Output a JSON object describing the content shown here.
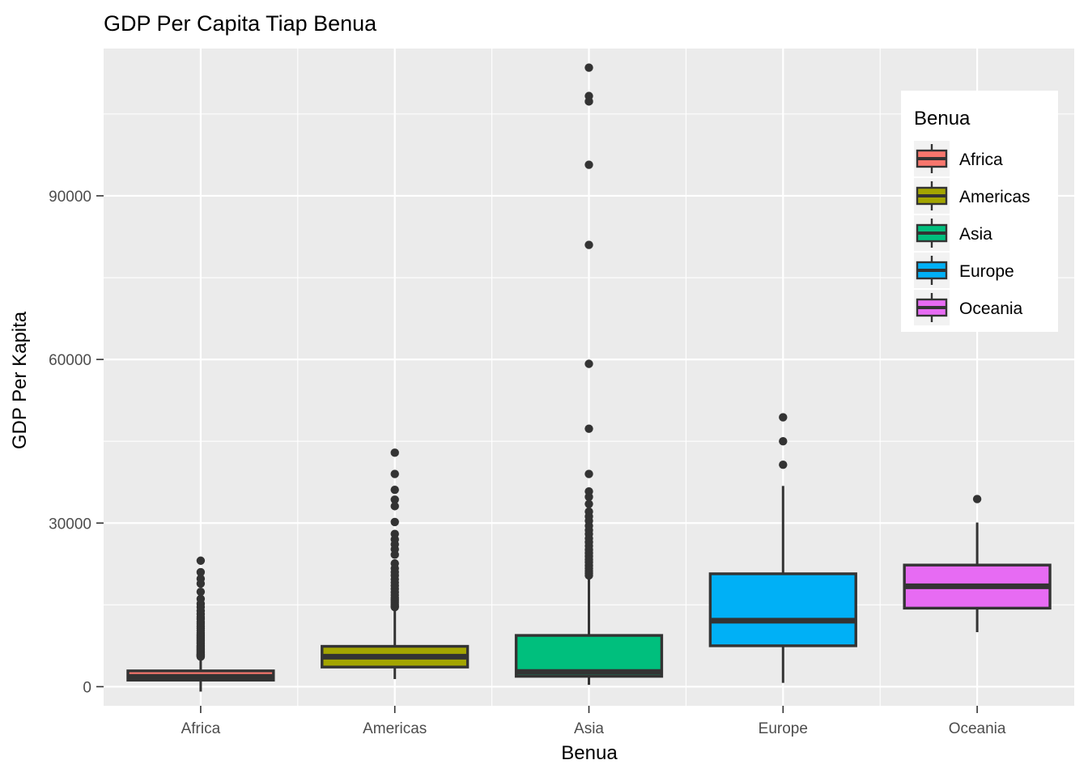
{
  "chart_data": {
    "type": "box",
    "title": "GDP Per Capita Tiap Benua",
    "xlabel": "Benua",
    "ylabel": "GDP Per Kapita",
    "categories": [
      "Africa",
      "Americas",
      "Asia",
      "Europe",
      "Oceania"
    ],
    "ytick_labels": [
      "0",
      "30000",
      "60000",
      "90000"
    ],
    "ytick_values": [
      0,
      30000,
      60000,
      90000
    ],
    "yminor_values": [
      15000,
      45000,
      75000,
      105000
    ],
    "ylim": [
      -3500,
      117000
    ],
    "grid": true,
    "legend_position": "right-inside-top",
    "legend_title": "Benua",
    "colors": {
      "Africa": "#F8766D",
      "Americas": "#A3A500",
      "Asia": "#00BF7D",
      "Europe": "#00B0F6",
      "Oceania": "#E76BF3",
      "panel": "#EBEBEB",
      "grid": "#FFFFFF",
      "ink": "#333333",
      "tick_text": "#4D4D4D"
    },
    "boxes": [
      {
        "name": "Africa",
        "color": "#F8766D",
        "lower_whisker": -900,
        "q1": 1200,
        "median": 1800,
        "q3": 2900,
        "upper_whisker": 5400,
        "outliers": [
          23100,
          21000,
          19800,
          18900,
          17400,
          16100,
          15200,
          14600,
          13900,
          13300,
          12800,
          12400,
          11900,
          11500,
          11100,
          10700,
          10300,
          9900,
          9600,
          9300,
          9000,
          8700,
          8400,
          8100,
          7900,
          7600,
          7400,
          7200,
          7000,
          6800,
          6600,
          6400,
          6200,
          6000,
          5900,
          5800,
          5700,
          5600,
          5500
        ]
      },
      {
        "name": "Americas",
        "color": "#A3A500",
        "lower_whisker": 1400,
        "q1": 3600,
        "median": 5500,
        "q3": 7400,
        "upper_whisker": 14300,
        "outliers": [
          42900,
          39000,
          36100,
          34300,
          33100,
          30200,
          28000,
          27000,
          26100,
          25200,
          24200,
          22600,
          21700,
          21000,
          20400,
          19700,
          19100,
          18500,
          17900,
          17300,
          16800,
          16300,
          15900,
          15500,
          15100,
          14800,
          14600
        ]
      },
      {
        "name": "Asia",
        "color": "#00BF7D",
        "lower_whisker": 331,
        "q1": 1900,
        "median": 2700,
        "q3": 9400,
        "upper_whisker": 20100,
        "outliers": [
          113500,
          108300,
          107300,
          95700,
          81000,
          59200,
          47300,
          39000,
          35800,
          34800,
          33500,
          32100,
          31200,
          30400,
          29500,
          28700,
          28000,
          27200,
          26500,
          25800,
          25100,
          24500,
          23900,
          23300,
          22800,
          22200,
          21700,
          21200,
          20800,
          20400
        ]
      },
      {
        "name": "Europe",
        "color": "#00B0F6",
        "lower_whisker": 700,
        "q1": 7500,
        "median": 12100,
        "q3": 20700,
        "upper_whisker": 36800,
        "outliers": [
          49400,
          45000,
          40700
        ]
      },
      {
        "name": "Oceania",
        "color": "#E76BF3",
        "lower_whisker": 10000,
        "q1": 14400,
        "median": 18400,
        "q3": 22300,
        "upper_whisker": 30100,
        "outliers": [
          34400
        ]
      }
    ],
    "legend_entries": [
      {
        "label": "Africa",
        "color": "#F8766D"
      },
      {
        "label": "Americas",
        "color": "#A3A500"
      },
      {
        "label": "Asia",
        "color": "#00BF7D"
      },
      {
        "label": "Europe",
        "color": "#00B0F6"
      },
      {
        "label": "Oceania",
        "color": "#E76BF3"
      }
    ]
  }
}
